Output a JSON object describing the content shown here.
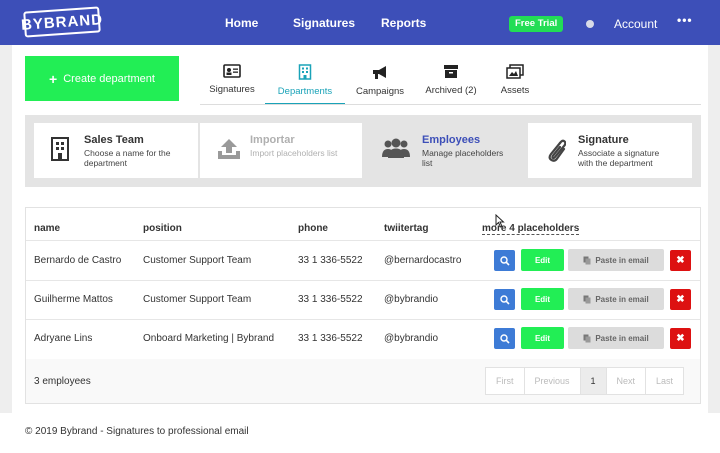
{
  "logo": "BYBRAND",
  "nav": {
    "home": "Home",
    "signatures": "Signatures",
    "reports": "Reports",
    "free_trial": "Free Trial",
    "account": "Account",
    "more": "•••"
  },
  "create_button": "Create department",
  "tabs": [
    {
      "label": "Signatures",
      "icon": "id-card-icon"
    },
    {
      "label": "Departments",
      "icon": "building-icon"
    },
    {
      "label": "Campaigns",
      "icon": "megaphone-icon"
    },
    {
      "label": "Archived (2)",
      "icon": "archive-icon"
    },
    {
      "label": "Assets",
      "icon": "images-icon"
    }
  ],
  "steps": [
    {
      "title": "Sales Team",
      "desc1": "Choose a name for the",
      "desc2": "department",
      "icon": "building-icon"
    },
    {
      "title": "Importar",
      "desc1": "Import placeholders list",
      "desc2": "",
      "icon": "upload-icon"
    },
    {
      "title": "Employees",
      "desc1": "Manage placeholders",
      "desc2": "list",
      "icon": "users-icon"
    },
    {
      "title": "Signature",
      "desc1": "Associate a signature",
      "desc2": "with the department",
      "icon": "paperclip-icon"
    }
  ],
  "table": {
    "headers": [
      "name",
      "position",
      "phone",
      "twiitertag",
      "more 4 placeholders"
    ],
    "rows": [
      {
        "name": "Bernardo de Castro",
        "position": "Customer Support Team",
        "phone": "33 1 336-5522",
        "tag": "@bernardocastro"
      },
      {
        "name": "Guilherme Mattos",
        "position": "Customer Support Team",
        "phone": "33 1 336-5522",
        "tag": "@bybrandio"
      },
      {
        "name": "Adryane Lins",
        "position": "Onboard Marketing | Bybrand",
        "phone": "33 1 336-5522",
        "tag": "@bybrandio"
      }
    ],
    "edit_label": "Edit",
    "paste_label": "Paste in email",
    "delete_label": "✖",
    "count": "3 employees",
    "pager": [
      "First",
      "Previous",
      "1",
      "Next",
      "Last"
    ]
  },
  "colors": {
    "nav": "#3d4fb8",
    "accent": "#22ee55",
    "teal": "#1aa3b8",
    "danger": "#dd1111",
    "info": "#3d7bd6"
  },
  "footer": "© 2019 Bybrand - Signatures to professional email"
}
